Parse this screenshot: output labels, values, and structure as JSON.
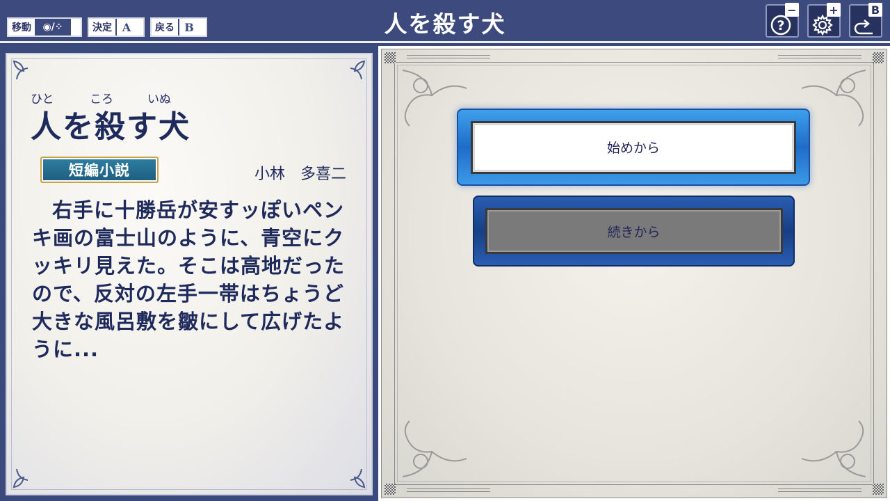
{
  "header": {
    "title": "人を殺す犬",
    "hints": [
      {
        "label": "移動",
        "key": "◉/⁘"
      },
      {
        "label": "決定",
        "key": "A"
      },
      {
        "label": "戻る",
        "key": "B"
      }
    ],
    "buttons": [
      {
        "icon": "help-icon",
        "corner": "−"
      },
      {
        "icon": "gear-icon",
        "corner": "+"
      },
      {
        "icon": "return-icon",
        "corner": "B"
      }
    ]
  },
  "book": {
    "ruby": [
      "ひと",
      "ころ",
      "いぬ"
    ],
    "title": "人を殺す犬",
    "genre": "短編小説",
    "author": "小林　多喜二",
    "excerpt": "右手に十勝岳が安すッぽいペンキ画の富士山のように、青空にクッキリ見えた。そこは高地だったので、反対の左手一帯はちょうど大きな風呂敷を皺にして広げたように..."
  },
  "menu": {
    "start_label": "始めから",
    "continue_label": "続きから",
    "selected": "start"
  },
  "colors": {
    "bar": "#3c4a7d",
    "title_text": "#1f2a5c",
    "selected_button": "#2f88e0"
  }
}
